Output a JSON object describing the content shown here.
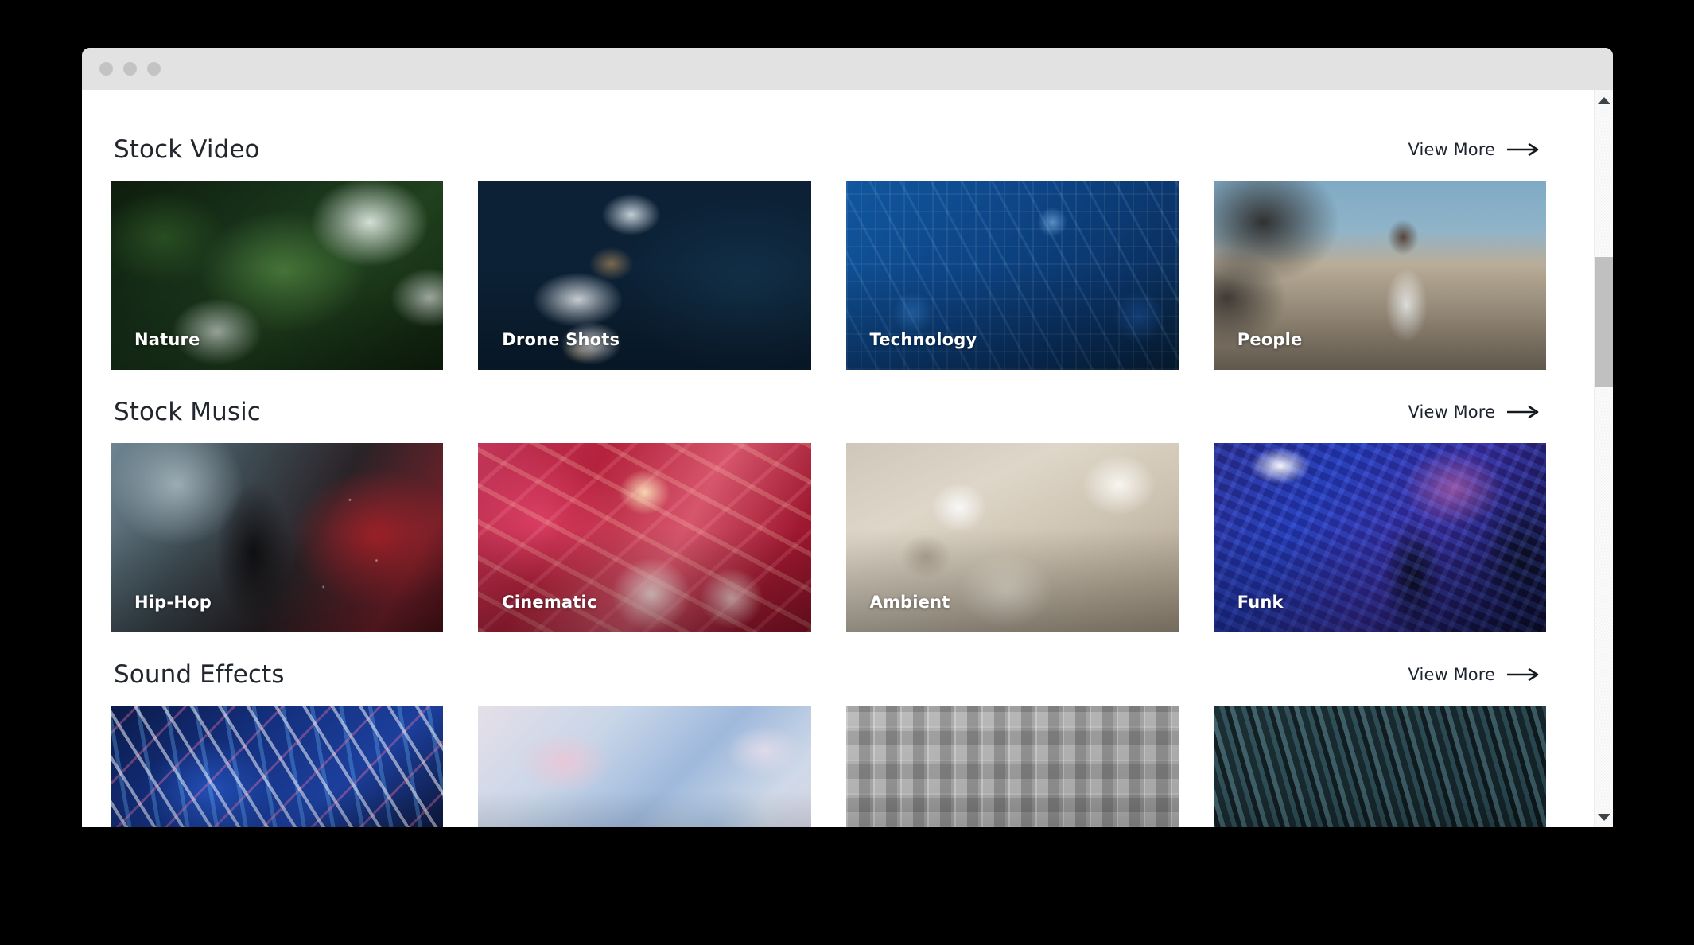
{
  "window": {
    "titlebar": {
      "dots": [
        "close-dot",
        "minimize-dot",
        "maximize-dot"
      ]
    }
  },
  "scrollbar": {
    "up_arrow_icon": "caret-up-icon",
    "down_arrow_icon": "caret-down-icon",
    "thumb_label": "scrollbar-thumb"
  },
  "view_more_label": "View More",
  "arrow_icon": "arrow-right-icon",
  "sections": [
    {
      "title": "Stock Video",
      "view_more": "View More",
      "cards": [
        {
          "label": "Nature",
          "art": "art-nature"
        },
        {
          "label": "Drone Shots",
          "art": "art-drone"
        },
        {
          "label": "Technology",
          "art": "art-tech"
        },
        {
          "label": "People",
          "art": "art-people"
        }
      ]
    },
    {
      "title": "Stock Music",
      "view_more": "View More",
      "cards": [
        {
          "label": "Hip-Hop",
          "art": "art-hiphop"
        },
        {
          "label": "Cinematic",
          "art": "art-cinematic"
        },
        {
          "label": "Ambient",
          "art": "art-ambient"
        },
        {
          "label": "Funk",
          "art": "art-funk"
        }
      ]
    },
    {
      "title": "Sound Effects",
      "view_more": "View More",
      "cards": [
        {
          "label": "",
          "art": "art-sfx1"
        },
        {
          "label": "",
          "art": "art-sfx2"
        },
        {
          "label": "",
          "art": "art-sfx3"
        },
        {
          "label": "",
          "art": "art-sfx4"
        }
      ]
    }
  ],
  "colors": {
    "page_background": "#ffffff",
    "outer_background": "#000000",
    "titlebar": "#e2e2e2",
    "titlebar_dot": "#c3c3c3",
    "heading_text": "#22272e",
    "link_text": "#1d2430",
    "card_label_text": "#ffffff",
    "scrollbar_thumb": "#c0c0c0"
  }
}
